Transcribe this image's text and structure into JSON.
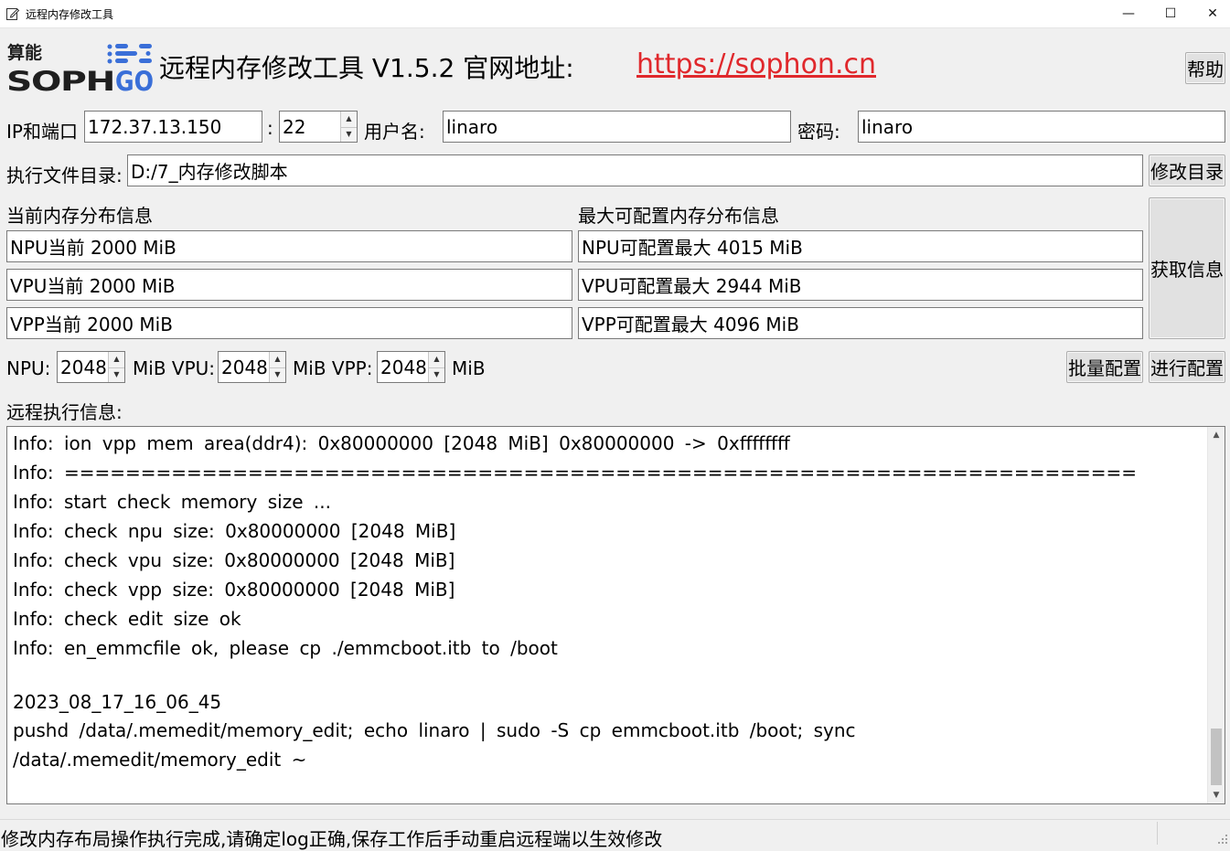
{
  "window": {
    "title": "远程内存修改工具",
    "minimize": "—",
    "maximize": "☐",
    "close": "✕"
  },
  "header": {
    "title": "远程内存修改工具  V1.5.2  官网地址:",
    "link": "https://sophon.cn",
    "help_button": "帮助",
    "logo": {
      "cn_text": "算能",
      "brand": "SOPHGO",
      "brand_color": "#1f1f1f",
      "accent": "#3a6fd8"
    }
  },
  "connection": {
    "ip_label": "IP和端口",
    "ip_value": "172.37.13.150",
    "colon": ":",
    "port_value": "22",
    "user_label": "用户名:",
    "user_value": "linaro",
    "password_label": "密码:",
    "password_value": "linaro"
  },
  "directory": {
    "label": "执行文件目录:",
    "value": "D:/7_内存修改脚本",
    "change_button": "修改目录"
  },
  "current": {
    "heading": "当前内存分布信息",
    "npu": "NPU当前  2000  MiB",
    "vpu": "VPU当前  2000  MiB",
    "vpp": "VPP当前  2000  MiB"
  },
  "max": {
    "heading": "最大可配置内存分布信息",
    "npu": "NPU可配置最大  4015  MiB",
    "vpu": "VPU可配置最大  2944  MiB",
    "vpp": "VPP可配置最大  4096  MiB"
  },
  "get_info_button": "获取信息",
  "config": {
    "npu_label": "NPU:",
    "npu_value": "2048",
    "vpu_label": "MiB VPU:",
    "vpu_value": "2048",
    "vpp_label": "MiB VPP:",
    "vpp_value": "2048",
    "unit": "MiB",
    "batch_button": "批量配置",
    "apply_button": "进行配置"
  },
  "log": {
    "heading": "远程执行信息:",
    "lines": [
      "Info: ion vpp mem area(ddr4): 0x80000000 [2048 MiB] 0x80000000 -> 0xffffffff",
      "Info: ======================================================================",
      "Info: start check memory size ...",
      "Info: check npu size: 0x80000000 [2048 MiB]",
      "Info: check vpu size: 0x80000000 [2048 MiB]",
      "Info: check vpp size: 0x80000000 [2048 MiB]",
      "Info: check edit size ok",
      "Info: en_emmcfile ok, please cp ./emmcboot.itb to /boot",
      "",
      "2023_08_17_16_06_45",
      "pushd /data/.memedit/memory_edit; echo linaro | sudo -S cp emmcboot.itb /boot; sync",
      "/data/.memedit/memory_edit ~"
    ]
  },
  "status": {
    "message": "修改内存布局操作执行完成,请确定log正确,保存工作后手动重启远程端以生效修改"
  }
}
